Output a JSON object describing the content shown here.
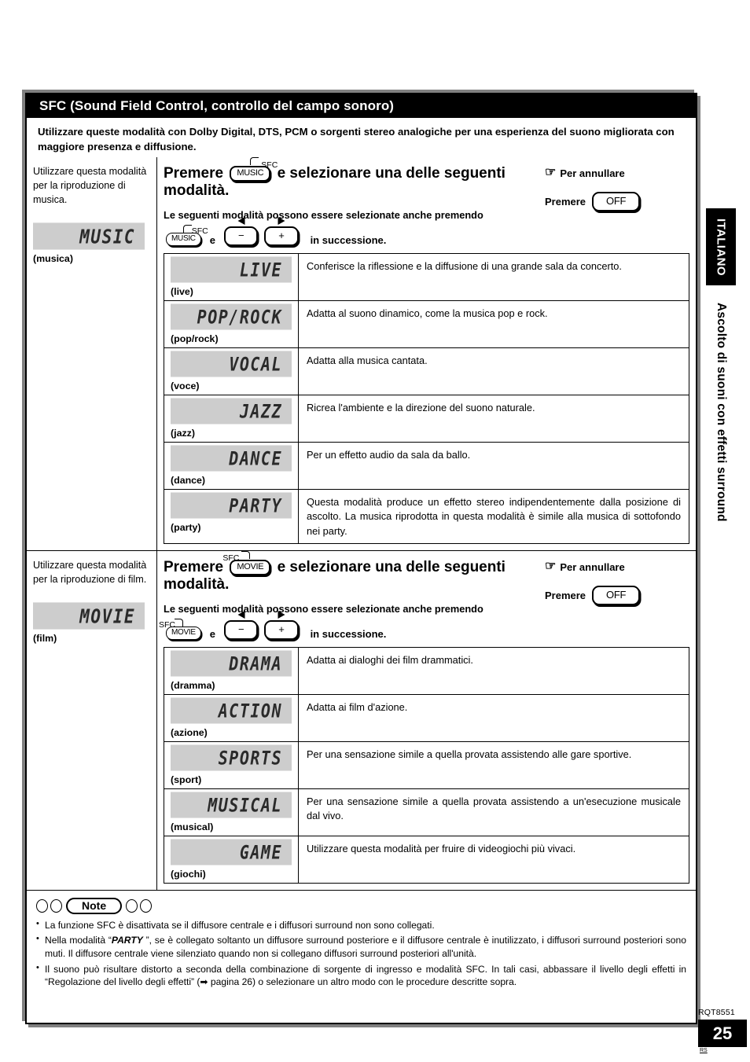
{
  "header": {
    "title": "SFC (Sound Field Control, controllo del campo sonoro)",
    "intro": "Utilizzare queste modalità con Dolby Digital, DTS, PCM o sorgenti stereo analogiche per una esperienza del suono migliorata con maggiore presenza e diffusione."
  },
  "sidebar": {
    "language_tab": "ITALIANO",
    "chapter_title": "Ascolto di suoni con effetti surround"
  },
  "footer": {
    "doc_code": "RQT8551",
    "page_number": "25",
    "page_sub": "RS"
  },
  "music_section": {
    "left_description": "Utilizzare questa modalità per la riproduzione di musica.",
    "left_lcd": "MUSIC",
    "left_lcd_caption": "(musica)",
    "headline_prefix": "Premere",
    "headline_key": "MUSIC",
    "headline_key_flag": "SFC",
    "headline_suffix": "e selezionare una delle seguenti",
    "headline_line2": "modalità.",
    "cancel_label": "Per annullare",
    "cancel_hand_icon": "pointing-hand-icon",
    "cancel_press": "Premere",
    "cancel_key": "OFF",
    "subhead": "Le seguenti modalità possono essere selezionate anche premendo",
    "press_key": "MUSIC",
    "press_key_flag": "SFC",
    "press_and": "e",
    "press_minus": "−",
    "press_plus": "+",
    "press_suffix": "in successione.",
    "modes": [
      {
        "lcd": "LIVE",
        "caption": "(live)",
        "text": "Conferisce la riflessione e la diffusione di una grande sala da concerto."
      },
      {
        "lcd": "POP/ROCK",
        "caption": "(pop/rock)",
        "text": "Adatta al suono dinamico, come la musica pop e rock."
      },
      {
        "lcd": "VOCAL",
        "caption": "(voce)",
        "text": "Adatta alla musica cantata."
      },
      {
        "lcd": "JAZZ",
        "caption": "(jazz)",
        "text": "Ricrea l'ambiente e la direzione del suono naturale."
      },
      {
        "lcd": "DANCE",
        "caption": "(dance)",
        "text": "Per un effetto audio da sala da ballo."
      },
      {
        "lcd": "PARTY",
        "caption": "(party)",
        "text": "Questa modalità produce un effetto stereo indipendentemente dalla posizione di ascolto. La musica riprodotta in questa modalità è simile alla musica di sottofondo nei party."
      }
    ]
  },
  "movie_section": {
    "left_description": "Utilizzare questa modalità per la riproduzione di film.",
    "left_lcd": "MOVIE",
    "left_lcd_caption": "(film)",
    "headline_prefix": "Premere",
    "headline_key": "MOVIE",
    "headline_key_flag": "SFC",
    "headline_suffix": "e selezionare una delle seguenti",
    "headline_line2": "modalità.",
    "cancel_label": "Per annullare",
    "cancel_hand_icon": "pointing-hand-icon",
    "cancel_press": "Premere",
    "cancel_key": "OFF",
    "subhead": "Le seguenti modalità possono essere selezionate anche premendo",
    "press_key": "MOVIE",
    "press_key_flag": "SFC",
    "press_and": "e",
    "press_minus": "−",
    "press_plus": "+",
    "press_suffix": "in successione.",
    "modes": [
      {
        "lcd": "DRAMA",
        "caption": "(dramma)",
        "text": "Adatta ai dialoghi dei film drammatici."
      },
      {
        "lcd": "ACTION",
        "caption": "(azione)",
        "text": "Adatta ai film d'azione."
      },
      {
        "lcd": "SPORTS",
        "caption": "(sport)",
        "text": "Per una sensazione simile a quella provata assistendo alle gare sportive."
      },
      {
        "lcd": "MUSICAL",
        "caption": "(musical)",
        "text": "Per una sensazione simile a quella provata assistendo a un'esecuzione musicale dal vivo."
      },
      {
        "lcd": "GAME",
        "caption": "(giochi)",
        "text": "Utilizzare questa modalità per fruire di videogiochi più vivaci."
      }
    ]
  },
  "note": {
    "label": "Note",
    "bullets": [
      {
        "pre": "La funzione SFC è disattivata se il diffusore centrale e i diffusori surround non sono collegati.",
        "em": "",
        "post": ""
      },
      {
        "pre": "Nella modalità “",
        "em": "PARTY",
        "post": " ”, se è collegato soltanto un diffusore surround posteriore e il diffusore centrale è inutilizzato, i diffusori surround posteriori sono muti. Il diffusore centrale viene silenziato quando non si collegano diffusori surround posteriori all'unità."
      },
      {
        "pre": "Il suono può risultare distorto a seconda della combinazione di sorgente di ingresso e modalità SFC. In tali casi, abbassare il livello degli effetti in “Regolazione del livello degli effetti” (➡ pagina 26) o selezionare un altro modo con le procedure descritte sopra.",
        "em": "",
        "post": ""
      }
    ]
  }
}
